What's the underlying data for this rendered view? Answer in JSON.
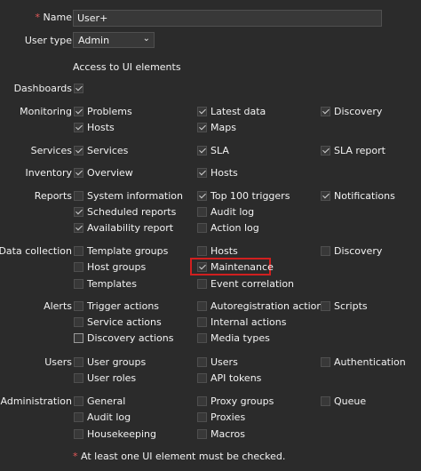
{
  "name_label": "Name",
  "name_required_mark": "*",
  "name_value": "User+",
  "user_type_label": "User type",
  "user_type_value": "Admin",
  "access_heading": "Access to UI elements",
  "groups": [
    {
      "label": "Dashboards",
      "items": [
        {
          "label": "",
          "checked": true
        }
      ]
    },
    {
      "label": "Monitoring",
      "items": [
        {
          "label": "Problems",
          "checked": true
        },
        {
          "label": "Latest data",
          "checked": true
        },
        {
          "label": "Discovery",
          "checked": true
        },
        {
          "label": "Hosts",
          "checked": true
        },
        {
          "label": "Maps",
          "checked": true
        }
      ]
    },
    {
      "label": "Services",
      "items": [
        {
          "label": "Services",
          "checked": true
        },
        {
          "label": "SLA",
          "checked": true
        },
        {
          "label": "SLA report",
          "checked": true
        }
      ]
    },
    {
      "label": "Inventory",
      "items": [
        {
          "label": "Overview",
          "checked": true
        },
        {
          "label": "Hosts",
          "checked": true
        }
      ]
    },
    {
      "label": "Reports",
      "items": [
        {
          "label": "System information",
          "checked": false
        },
        {
          "label": "Top 100 triggers",
          "checked": true
        },
        {
          "label": "Notifications",
          "checked": true
        },
        {
          "label": "Scheduled reports",
          "checked": true
        },
        {
          "label": "Audit log",
          "checked": false
        },
        {
          "label": "Availability report",
          "checked": true
        },
        {
          "label": "Action log",
          "checked": false
        }
      ]
    },
    {
      "label": "Data collection",
      "items": [
        {
          "label": "Template groups",
          "checked": false
        },
        {
          "label": "Hosts",
          "checked": false
        },
        {
          "label": "Discovery",
          "checked": false
        },
        {
          "label": "Host groups",
          "checked": false
        },
        {
          "label": "Maintenance",
          "checked": true
        },
        {
          "label": "Templates",
          "checked": false
        },
        {
          "label": "Event correlation",
          "checked": false
        }
      ]
    },
    {
      "label": "Alerts",
      "items": [
        {
          "label": "Trigger actions",
          "checked": false
        },
        {
          "label": "Autoregistration actions",
          "checked": false
        },
        {
          "label": "Scripts",
          "checked": false
        },
        {
          "label": "Service actions",
          "checked": false
        },
        {
          "label": "Internal actions",
          "checked": false
        },
        {
          "label": "Discovery actions",
          "checked": false
        },
        {
          "label": "Media types",
          "checked": false
        }
      ]
    },
    {
      "label": "Users",
      "items": [
        {
          "label": "User groups",
          "checked": false
        },
        {
          "label": "Users",
          "checked": false
        },
        {
          "label": "Authentication",
          "checked": false
        },
        {
          "label": "User roles",
          "checked": false
        },
        {
          "label": "API tokens",
          "checked": false
        }
      ]
    },
    {
      "label": "Administration",
      "items": [
        {
          "label": "General",
          "checked": false
        },
        {
          "label": "Proxy groups",
          "checked": false
        },
        {
          "label": "Queue",
          "checked": false
        },
        {
          "label": "Audit log",
          "checked": false
        },
        {
          "label": "Proxies",
          "checked": false
        },
        {
          "label": "Housekeeping",
          "checked": false
        },
        {
          "label": "Macros",
          "checked": false
        }
      ]
    }
  ],
  "footnote_mark": "*",
  "footnote": "At least one UI element must be checked."
}
